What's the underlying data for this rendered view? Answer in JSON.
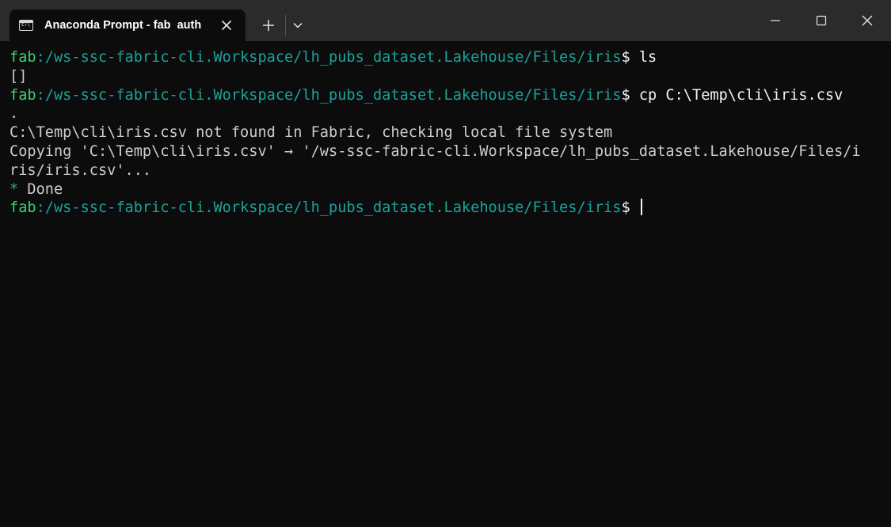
{
  "window": {
    "tab_title": "Anaconda Prompt - fab  auth",
    "icons": {
      "tab_icon": "terminal-icon",
      "tab_close": "close-icon",
      "new_tab": "plus-icon",
      "dropdown": "chevron-down-icon",
      "minimize": "minimize-icon",
      "maximize": "maximize-icon",
      "close": "close-icon"
    }
  },
  "colors": {
    "background": "#0c0c0c",
    "titlebar": "#2b2b2b",
    "prompt_user": "#3bd16f",
    "prompt_path": "#19a39a",
    "text": "#cccccc",
    "done_star": "#23b26b"
  },
  "terminal": {
    "prompt_user": "fab",
    "prompt_path": ":/ws-ssc-fabric-cli.Workspace/lh_pubs_dataset.Lakehouse/Files/iris",
    "prompt_symbol": "$",
    "lines": [
      {
        "kind": "prompt",
        "cmd": " ls"
      },
      {
        "kind": "output",
        "text": "[]"
      },
      {
        "kind": "prompt",
        "cmd": " cp C:\\Temp\\cli\\iris.csv"
      },
      {
        "kind": "output",
        "text": "."
      },
      {
        "kind": "output",
        "text": "C:\\Temp\\cli\\iris.csv not found in Fabric, checking local file system"
      },
      {
        "kind": "output",
        "text": "Copying 'C:\\Temp\\cli\\iris.csv' → '/ws-ssc-fabric-cli.Workspace/lh_pubs_dataset.Lakehouse/Files/i"
      },
      {
        "kind": "output",
        "text": "ris/iris.csv'..."
      },
      {
        "kind": "done",
        "star": "*",
        "text": " Done"
      },
      {
        "kind": "prompt",
        "cmd": " "
      }
    ]
  }
}
